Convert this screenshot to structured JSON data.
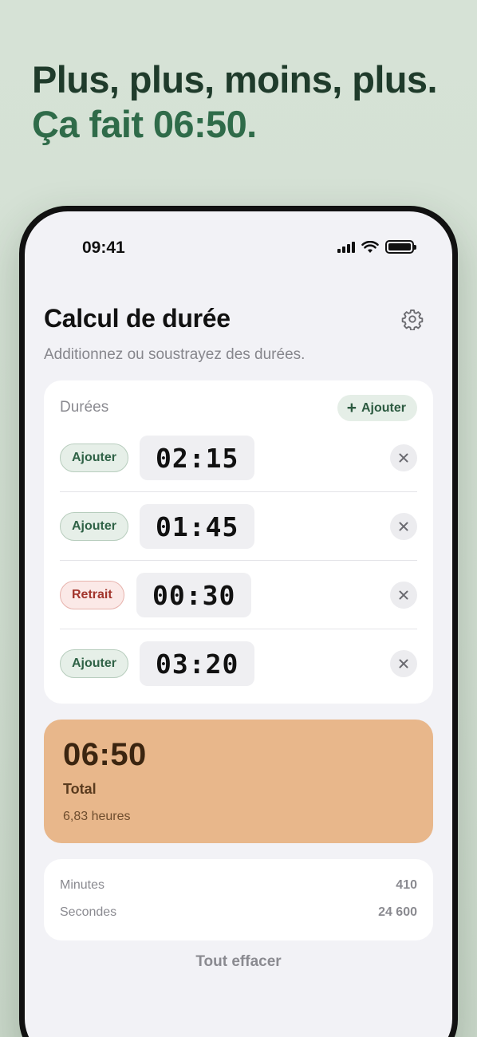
{
  "headline": {
    "line1": "Plus, plus, moins, plus.",
    "line2": "Ça fait 06:50."
  },
  "status": {
    "time": "09:41",
    "icons": [
      "cellular-signal-icon",
      "wifi-icon",
      "battery-icon"
    ]
  },
  "app": {
    "title": "Calcul de durée",
    "subtitle": "Additionnez ou soustrayez des durées.",
    "settings_icon": "gear-icon"
  },
  "durations": {
    "label": "Durées",
    "add_button": "Ajouter",
    "items": [
      {
        "mode": "Ajouter",
        "kind": "add",
        "time": "02:15"
      },
      {
        "mode": "Ajouter",
        "kind": "add",
        "time": "01:45"
      },
      {
        "mode": "Retrait",
        "kind": "sub",
        "time": "00:30"
      },
      {
        "mode": "Ajouter",
        "kind": "add",
        "time": "03:20"
      }
    ]
  },
  "total": {
    "value": "06:50",
    "label": "Total",
    "hours": "6,83 heures"
  },
  "stats": [
    {
      "label": "Minutes",
      "value": "410"
    },
    {
      "label": "Secondes",
      "value": "24 600"
    }
  ],
  "clear_all": "Tout effacer",
  "colors": {
    "background": "#d6e2d6",
    "headline_dark": "#1f3b2b",
    "headline_green": "#2f6b49",
    "add_pill": "#e6efe8",
    "sub_pill": "#fbe9e7",
    "total_card": "#e8b78b"
  }
}
